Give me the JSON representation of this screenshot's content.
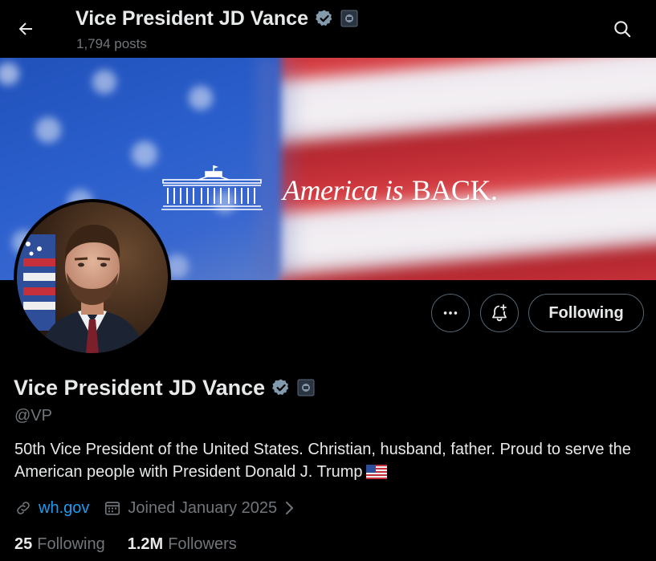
{
  "header": {
    "title": "Vice President JD Vance",
    "posts_count": "1,794 posts"
  },
  "banner": {
    "tagline_italic": "America is",
    "tagline_upright": "BACK."
  },
  "profile": {
    "display_name": "Vice President JD Vance",
    "handle": "@VP",
    "bio": "50th Vice President of the United States. Christian, husband, father. Proud to serve the American people with President Donald J. Trump",
    "website": "wh.gov",
    "joined": "Joined January 2025",
    "following_count": "25",
    "following_label": "Following",
    "followers_count": "1.2M",
    "followers_label": "Followers"
  },
  "actions": {
    "following_button": "Following"
  },
  "icons": {
    "back": "arrow-left-icon",
    "search": "search-icon",
    "more": "more-horizontal-icon",
    "notify": "bell-plus-icon",
    "verified": "verified-badge-icon",
    "gov": "government-badge-icon",
    "link": "link-icon",
    "calendar": "calendar-icon",
    "chevron": "chevron-right-icon",
    "flag": "us-flag-emoji"
  },
  "colors": {
    "background": "#000000",
    "text_primary": "#e7e9ea",
    "text_secondary": "#71767b",
    "link": "#1d9bf0",
    "verified_badge": "#829aab",
    "button_border": "#536471"
  }
}
